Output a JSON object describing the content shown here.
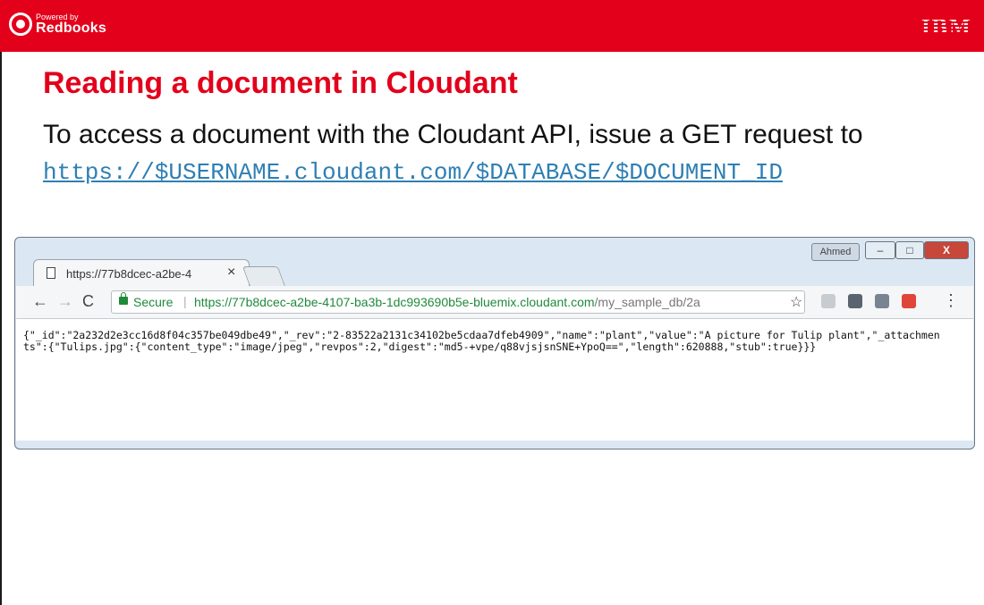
{
  "header": {
    "logo_powered": "Powered by",
    "logo_brand": "Redbooks",
    "company": "IBM",
    "color": "#e3001b"
  },
  "slide": {
    "title": "Reading a document in Cloudant",
    "body": "To access a document with the Cloudant API, issue a GET request to",
    "url": "https://$USERNAME.cloudant.com/$DATABASE/$DOCUMENT_ID"
  },
  "browser": {
    "tab_label": "https://77b8dcec-a2be-4",
    "tab_close": "×",
    "user_badge": "Ahmed",
    "window_buttons": {
      "minimize": "–",
      "maximize": "□",
      "close": "X"
    },
    "nav": {
      "back": "←",
      "forward": "→",
      "reload": "C"
    },
    "secure_label": "Secure",
    "separator": "|",
    "address_host": "https://77b8dcec-a2be-4107-ba3b-1dc993690b5e-bluemix.cloudant.com",
    "address_path": "/my_sample_db/2a",
    "star_icon": "☆",
    "menu_icon": "⋮",
    "extensions": [
      "cast-icon",
      "pocket-icon",
      "vpn-icon",
      "todoist-icon"
    ],
    "content": "{\"_id\":\"2a232d2e3cc16d8f04c357be049dbe49\",\"_rev\":\"2-83522a2131c34102be5cdaa7dfeb4909\",\"name\":\"plant\",\"value\":\"A picture for Tulip plant\",\"_attachments\":{\"Tulips.jpg\":{\"content_type\":\"image/jpeg\",\"revpos\":2,\"digest\":\"md5-+vpe/q88vjsjsnSNE+YpoQ==\",\"length\":620888,\"stub\":true}}}"
  }
}
